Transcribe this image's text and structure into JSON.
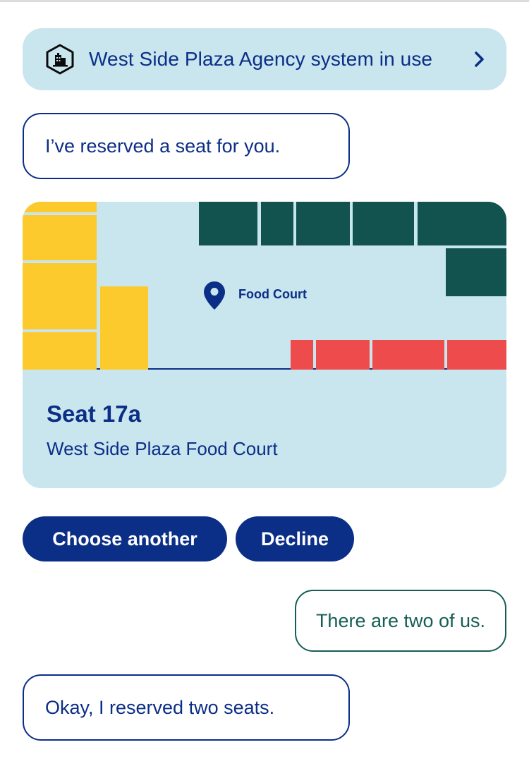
{
  "banner": {
    "text": "West Side Plaza Agency system in use",
    "icon": "building-icon",
    "chevron_icon": "chevron-right-icon"
  },
  "messages": {
    "agent_1": "I’ve reserved a seat for you.",
    "user_1": "There are two of us.",
    "agent_2": "Okay, I reserved two seats."
  },
  "seat_card": {
    "map_label": "Food Court",
    "pin_icon": "map-pin-icon",
    "seat_title": "Seat 17a",
    "seat_location": "West Side Plaza Food Court"
  },
  "actions": {
    "choose_another": "Choose another",
    "decline": "Decline"
  },
  "colors": {
    "brand_navy": "#0b2e86",
    "banner_bg": "#c9e6ee",
    "user_bubble": "#165e55",
    "map_yellow": "#fcca2c",
    "map_green": "#12524f",
    "map_red": "#ee4c4c"
  }
}
